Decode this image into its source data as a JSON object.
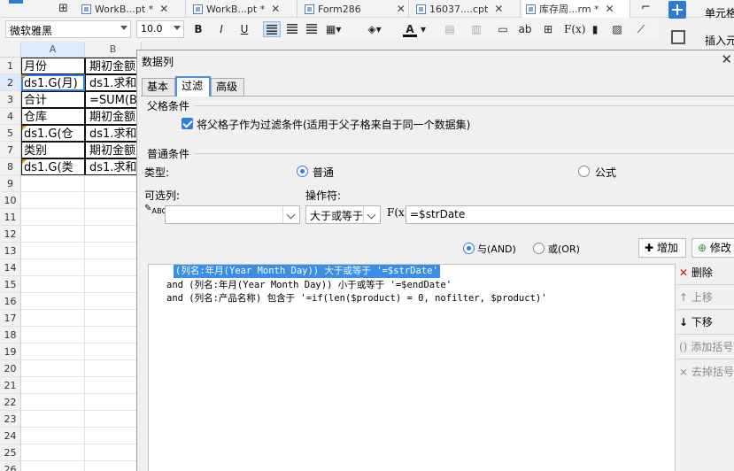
{
  "tabs": [
    {
      "label": "WorkB...pt *"
    },
    {
      "label": "WorkB...pt *"
    },
    {
      "label": "Form286"
    },
    {
      "label": "16037....cpt"
    },
    {
      "label": "库存周...rm *"
    }
  ],
  "side_panel": {
    "cell_element": "单元格",
    "insert": "插入元"
  },
  "toolbar": {
    "font": "微软雅黑",
    "size": "10.0",
    "bold": "B",
    "italic": "I",
    "underline": "U",
    "wrap": "ab",
    "formula": "F(x)"
  },
  "sheet": {
    "columns": [
      "A",
      "B"
    ],
    "rows": [
      "1",
      "2",
      "3",
      "4",
      "5",
      "7",
      "8",
      "9",
      "10",
      "11",
      "12",
      "13",
      "14",
      "15",
      "16",
      "17",
      "18",
      "19",
      "20",
      "21",
      "22",
      "23",
      "24",
      "25",
      "26"
    ],
    "cells": [
      {
        "a": "月份",
        "b": "期初金额"
      },
      {
        "a": "ds1.G(月)",
        "b": "ds1.求和"
      },
      {
        "a": "合计",
        "b": "=SUM(B"
      },
      {
        "a": "仓库",
        "b": "期初金额"
      },
      {
        "a": "ds1.G(仓",
        "b": "ds1.求和"
      },
      {
        "a": "类别",
        "b": "期初金额"
      },
      {
        "a": "ds1.G(类",
        "b": "ds1.求和"
      }
    ]
  },
  "dialog": {
    "title": "数据列",
    "tabs": {
      "basic": "基本",
      "filter": "过滤",
      "advanced": "高级"
    },
    "parent_section": "父格条件",
    "parent_checkbox": "将父格子作为过滤条件(适用于父子格来自于同一个数据集)",
    "normal_section": "普通条件",
    "type_label": "类型:",
    "type_normal": "普通",
    "type_formula": "公式",
    "column_label": "可选列:",
    "operator_label": "操作符:",
    "column_value": "",
    "operator_value": "大于或等于",
    "fx_label": "F(x)",
    "value": "=$strDate",
    "and_label": "与(AND)",
    "or_label": "或(OR)",
    "add_label": "增加",
    "modify_label": "修改",
    "conditions": [
      "(列名:年月(Year Month Day)) 大于或等于 '=$strDate'",
      "and (列名:年月(Year Month Day)) 小于或等于 '=$endDate'",
      "and (列名:产品名称) 包含于 '=if(len($product) = 0, nofilter, $product)'"
    ],
    "actions": {
      "delete": "删除",
      "up": "上移",
      "down": "下移",
      "add_paren": "添加括号",
      "remove_paren": "去掉括号"
    }
  }
}
